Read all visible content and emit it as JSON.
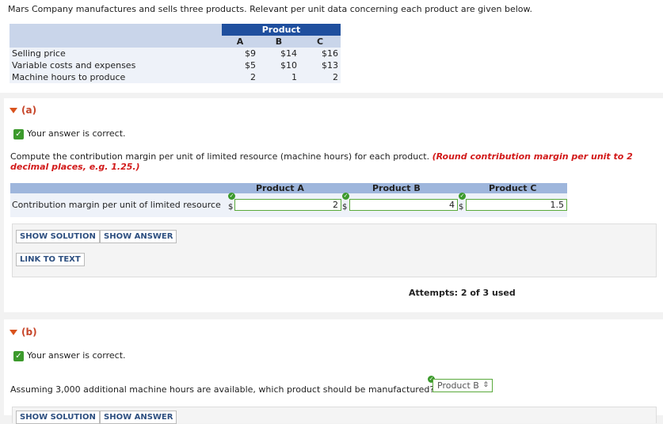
{
  "intro": "Mars Company manufactures and sells three products. Relevant per unit data concerning each product are given below.",
  "product_table": {
    "group_header": "Product",
    "columns": [
      "A",
      "B",
      "C"
    ],
    "rows": [
      {
        "label": "Selling price",
        "values": [
          "$9",
          "$14",
          "$16"
        ]
      },
      {
        "label": "Variable costs and expenses",
        "values": [
          "$5",
          "$10",
          "$13"
        ]
      },
      {
        "label": "Machine hours to produce",
        "values": [
          "2",
          "1",
          "2"
        ]
      }
    ]
  },
  "part_a": {
    "toggle": "(a)",
    "status": "Your answer is correct.",
    "question": "Compute the contribution margin per unit of limited resource (machine hours) for each product.",
    "instruction": "(Round contribution margin per unit to 2 decimal places, e.g. 1.25.)",
    "cm_headers": [
      "Product A",
      "Product B",
      "Product C"
    ],
    "cm_label": "Contribution margin per unit of limited resource",
    "currency": "$",
    "cm_values": [
      "2",
      "4",
      "1.5"
    ],
    "buttons": {
      "show_solution": "SHOW SOLUTION",
      "show_answer": "SHOW ANSWER",
      "link_to_text": "LINK TO TEXT"
    },
    "attempts": "Attempts: 2 of 3 used"
  },
  "part_b": {
    "toggle": "(b)",
    "status": "Your answer is correct.",
    "question": "Assuming 3,000 additional machine hours are available, which product should be manufactured?",
    "selected": "Product B",
    "buttons": {
      "show_solution": "SHOW SOLUTION",
      "show_answer": "SHOW ANSWER"
    }
  },
  "colors": {
    "header_blue": "#1f4f9e",
    "correct_green": "#3c9a2c",
    "toggle_orange": "#d9531e",
    "instruction_red": "#d21a1a"
  }
}
